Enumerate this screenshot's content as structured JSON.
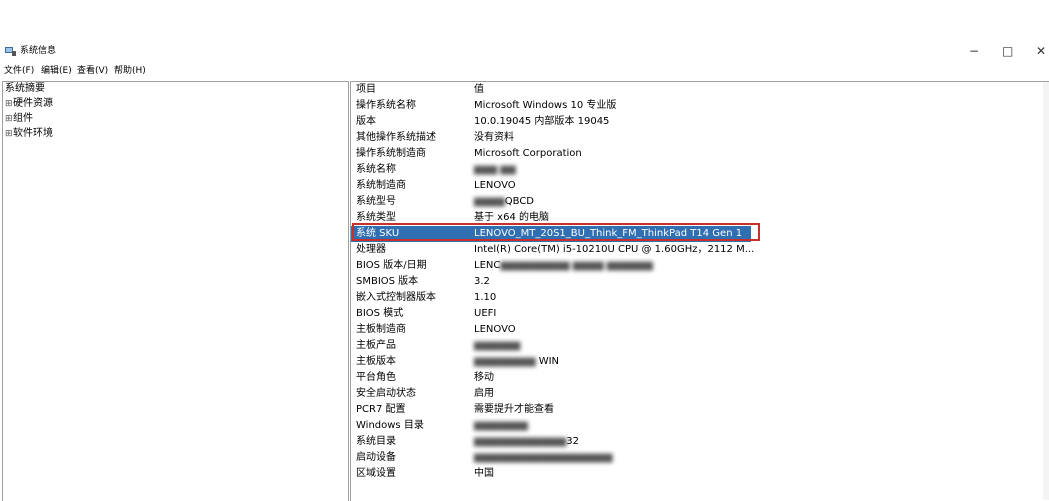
{
  "window": {
    "title": "系统信息",
    "app_icon": "system-info-icon",
    "buttons": {
      "minimize": "−",
      "maximize": "□",
      "close": "✕"
    }
  },
  "menu": [
    "文件(F)",
    "编辑(E)",
    "查看(V)",
    "帮助(H)"
  ],
  "tree": {
    "root": "系统摘要",
    "children": [
      {
        "expander": "⊞",
        "label": "硬件资源"
      },
      {
        "expander": "⊞",
        "label": "组件"
      },
      {
        "expander": "⊞",
        "label": "软件环境"
      }
    ]
  },
  "table": {
    "header": {
      "item": "项目",
      "value": "值"
    },
    "rows": [
      {
        "item": "操作系统名称",
        "value": "Microsoft Windows 10 专业版"
      },
      {
        "item": "版本",
        "value": "10.0.19045 内部版本 19045"
      },
      {
        "item": "其他操作系统描述",
        "value": "没有资料"
      },
      {
        "item": "操作系统制造商",
        "value": "Microsoft Corporation"
      },
      {
        "item": "系统名称",
        "value": ""
      },
      {
        "item": "系统制造商",
        "value": "LENOVO"
      },
      {
        "item": "系统型号",
        "value": "QBCD"
      },
      {
        "item": "系统类型",
        "value": "基于 x64 的电脑"
      },
      {
        "item": "系统 SKU",
        "value": "LENOVO_MT_20S1_BU_Think_FM_ThinkPad T14 Gen 1",
        "selected": true
      },
      {
        "item": "处理器",
        "value": "Intel(R) Core(TM) i5-10210U CPU @ 1.60GHz，2112 M..."
      },
      {
        "item": "BIOS 版本/日期",
        "value": "LENC"
      },
      {
        "item": "SMBIOS 版本",
        "value": "3.2"
      },
      {
        "item": "嵌入式控制器版本",
        "value": "1.10"
      },
      {
        "item": "BIOS 模式",
        "value": "UEFI"
      },
      {
        "item": "主板制造商",
        "value": "LENOVO"
      },
      {
        "item": "主板产品",
        "value": ""
      },
      {
        "item": "主板版本",
        "value": "WIN"
      },
      {
        "item": "平台角色",
        "value": "移动"
      },
      {
        "item": "安全启动状态",
        "value": "启用"
      },
      {
        "item": "PCR7 配置",
        "value": "需要提升才能查看"
      },
      {
        "item": "Windows 目录",
        "value": ""
      },
      {
        "item": "系统目录",
        "value": "32"
      },
      {
        "item": "启动设备",
        "value": ""
      },
      {
        "item": "区域设置",
        "value": "中国"
      }
    ]
  },
  "colors": {
    "selection": "#2f6fb2",
    "annotation_box": "#c8302b"
  }
}
